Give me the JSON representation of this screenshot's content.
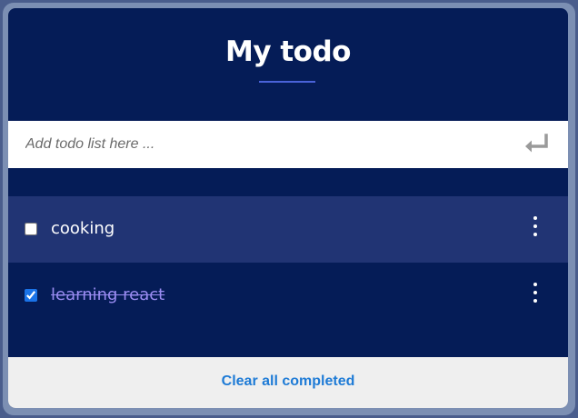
{
  "app": {
    "title": "My todo"
  },
  "new_todo": {
    "placeholder": "Add todo list here ...",
    "value": "",
    "submit_icon": "enter-return-icon"
  },
  "todos": [
    {
      "label": "cooking",
      "completed": false,
      "menu_icon": "vertical-dots-icon"
    },
    {
      "label": "learning react",
      "completed": true,
      "menu_icon": "vertical-dots-icon"
    }
  ],
  "footer": {
    "clear_label": "Clear all completed"
  },
  "colors": {
    "background": "#051c57",
    "active_row": "#213474",
    "accent": "#4a62d8",
    "completed_text": "#9a8cf2",
    "link": "#1e7bd6",
    "footer_bg": "#efefef"
  }
}
